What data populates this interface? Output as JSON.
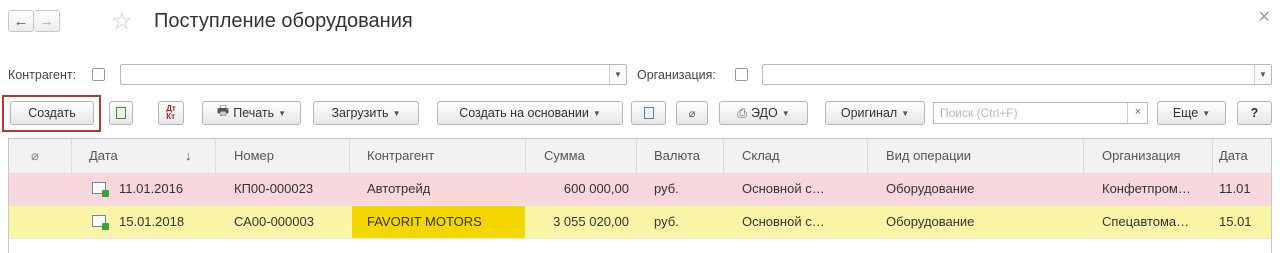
{
  "header": {
    "back_icon": "←",
    "forward_icon": "→",
    "star_icon": "☆",
    "title": "Поступление оборудования",
    "close_icon": "×"
  },
  "filters": {
    "counterparty_label": "Контрагент:",
    "counterparty_value": "",
    "organization_label": "Организация:",
    "organization_value": ""
  },
  "toolbar": {
    "create": "Создать",
    "print": "Печать",
    "load": "Загрузить",
    "create_based_on": "Создать на основании",
    "edo": "ЭДО",
    "original": "Оригинал",
    "search_placeholder": "Поиск (Ctrl+F)",
    "clear": "×",
    "more": "Еще",
    "help": "?",
    "arrow": "▾",
    "dt_kt_label": "Дт\nКт",
    "attach_icon": "📎"
  },
  "table": {
    "columns": [
      "Дата",
      "Номер",
      "Контрагент",
      "Сумма",
      "Валюта",
      "Склад",
      "Вид операции",
      "Организация",
      "Дата"
    ],
    "sort_indicator": "↓",
    "rows": [
      {
        "date": "11.01.2016",
        "number": "КП00-000023",
        "counterparty": "Автотрейд",
        "sum": "600 000,00",
        "currency": "руб.",
        "warehouse": "Основной с…",
        "operation": "Оборудование",
        "organization": "Конфетпром…",
        "date2": "11.01",
        "highlight": "#f8d8dc"
      },
      {
        "date": "15.01.2018",
        "number": "СА00-000003",
        "counterparty": "FAVORIT MOTORS",
        "sum": "3 055 020,00",
        "currency": "руб.",
        "warehouse": "Основной с…",
        "operation": "Оборудование",
        "organization": "Спецавтома…",
        "date2": "15.01",
        "highlight": "#fbf5a8"
      }
    ]
  },
  "colors": {
    "create_highlight_border": "#b03a2e",
    "counterparty_highlight": "#f5d700"
  }
}
